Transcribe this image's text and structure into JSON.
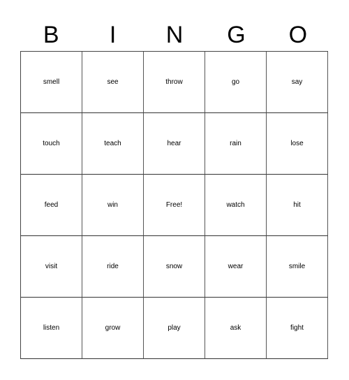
{
  "header": [
    "B",
    "I",
    "N",
    "G",
    "O"
  ],
  "cells": [
    [
      "smell",
      "see",
      "throw",
      "go",
      "say"
    ],
    [
      "touch",
      "teach",
      "hear",
      "rain",
      "lose"
    ],
    [
      "feed",
      "win",
      "Free!",
      "watch",
      "hit"
    ],
    [
      "visit",
      "ride",
      "snow",
      "wear",
      "smile"
    ],
    [
      "listen",
      "grow",
      "play",
      "ask",
      "fight"
    ]
  ]
}
